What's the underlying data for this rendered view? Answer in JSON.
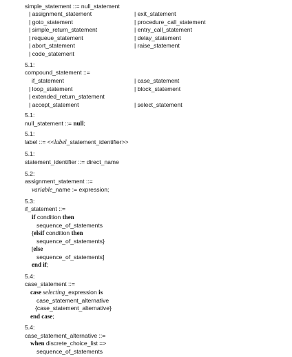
{
  "simple_statement": {
    "head": "simple_statement ::= null_statement",
    "left": [
      "| assignment_statement",
      "| goto_statement",
      "| simple_return_statement",
      "| requeue_statement",
      "| abort_statement",
      "| code_statement"
    ],
    "right": [
      "| exit_statement",
      "| procedure_call_statement",
      "| entry_call_statement",
      "| delay_statement",
      "| raise_statement"
    ]
  },
  "compound_statement": {
    "sec": "5.1:",
    "head": "compound_statement ::=",
    "left": [
      "if_statement",
      "| loop_statement",
      "| extended_return_statement",
      "| accept_statement"
    ],
    "right": [
      "| case_statement",
      "| block_statement",
      "",
      "| select_statement"
    ]
  },
  "null_statement": {
    "sec": "5.1:",
    "pre": "null_statement ::= ",
    "kw": "null",
    "post": ";"
  },
  "label": {
    "sec": "5.1:",
    "pre": "label ::= <<",
    "it": "label",
    "post": "_statement_identifier>>"
  },
  "statement_identifier": {
    "sec": "5.1:",
    "text": "statement_identifier ::= direct_name"
  },
  "assignment_statement": {
    "sec": "5.2:",
    "head": "assignment_statement ::=",
    "it": "variable",
    "post": "_name := expression;"
  },
  "if_statement": {
    "sec": "5.3:",
    "head": "if_statement ::=",
    "kw_if": "if",
    "cond1": " condition ",
    "kw_then": "then",
    "seq1": "sequence_of_statements",
    "brace_open": "{",
    "kw_elsif": "elsif",
    "cond2": " condition ",
    "kw_then2": "then",
    "seq2": "sequence_of_statements}",
    "bracket_open": "[",
    "kw_else": "else",
    "seq3": "sequence_of_statements]",
    "kw_end": "end if",
    "semi": ";"
  },
  "case_statement": {
    "sec": "5.4:",
    "head": "case_statement ::=",
    "kw_case": "case",
    "it": "selecting",
    "expr": "_expression ",
    "kw_is": "is",
    "alt1": "case_statement_alternative",
    "alt2": "{case_statement_alternative}",
    "kw_end": "end case",
    "semi": ";"
  },
  "case_statement_alternative": {
    "sec": "5.4:",
    "head": "case_statement_alternative ::=",
    "kw_when": "when",
    "rest": " discrete_choice_list =>",
    "seq": "sequence_of_statements"
  }
}
